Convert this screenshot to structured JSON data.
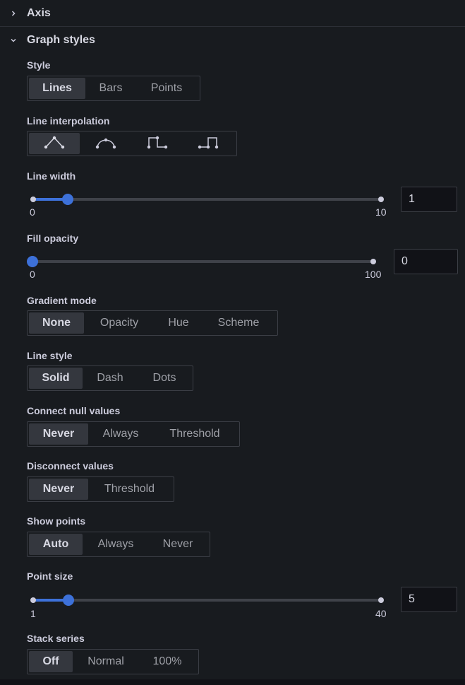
{
  "sections": {
    "axis": {
      "title": "Axis",
      "chevron_icon": "chevron-right-icon"
    },
    "graph_styles": {
      "title": "Graph styles",
      "chevron_icon": "chevron-down-icon"
    }
  },
  "style": {
    "label": "Style",
    "options": [
      "Lines",
      "Bars",
      "Points"
    ],
    "selected": "Lines"
  },
  "line_interpolation": {
    "label": "Line interpolation",
    "options": [
      "linear-icon",
      "smooth-icon",
      "step-before-icon",
      "step-after-icon"
    ],
    "selected": "linear-icon"
  },
  "line_width": {
    "label": "Line width",
    "min": "0",
    "max": "10",
    "value": "1",
    "fraction": 0.1
  },
  "fill_opacity": {
    "label": "Fill opacity",
    "min": "0",
    "max": "100",
    "value": "0",
    "fraction": 0
  },
  "gradient_mode": {
    "label": "Gradient mode",
    "options": [
      "None",
      "Opacity",
      "Hue",
      "Scheme"
    ],
    "selected": "None"
  },
  "line_style": {
    "label": "Line style",
    "options": [
      "Solid",
      "Dash",
      "Dots"
    ],
    "selected": "Solid"
  },
  "connect_null": {
    "label": "Connect null values",
    "options": [
      "Never",
      "Always",
      "Threshold"
    ],
    "selected": "Never"
  },
  "disconnect_values": {
    "label": "Disconnect values",
    "options": [
      "Never",
      "Threshold"
    ],
    "selected": "Never"
  },
  "show_points": {
    "label": "Show points",
    "options": [
      "Auto",
      "Always",
      "Never"
    ],
    "selected": "Auto"
  },
  "point_size": {
    "label": "Point size",
    "min": "1",
    "max": "40",
    "value": "5",
    "fraction": 0.1026
  },
  "stack_series": {
    "label": "Stack series",
    "options": [
      "Off",
      "Normal",
      "100%"
    ],
    "selected": "Off"
  },
  "colors": {
    "accent": "#3d71d9",
    "background": "#181b1f",
    "active_option": "#34373e"
  }
}
